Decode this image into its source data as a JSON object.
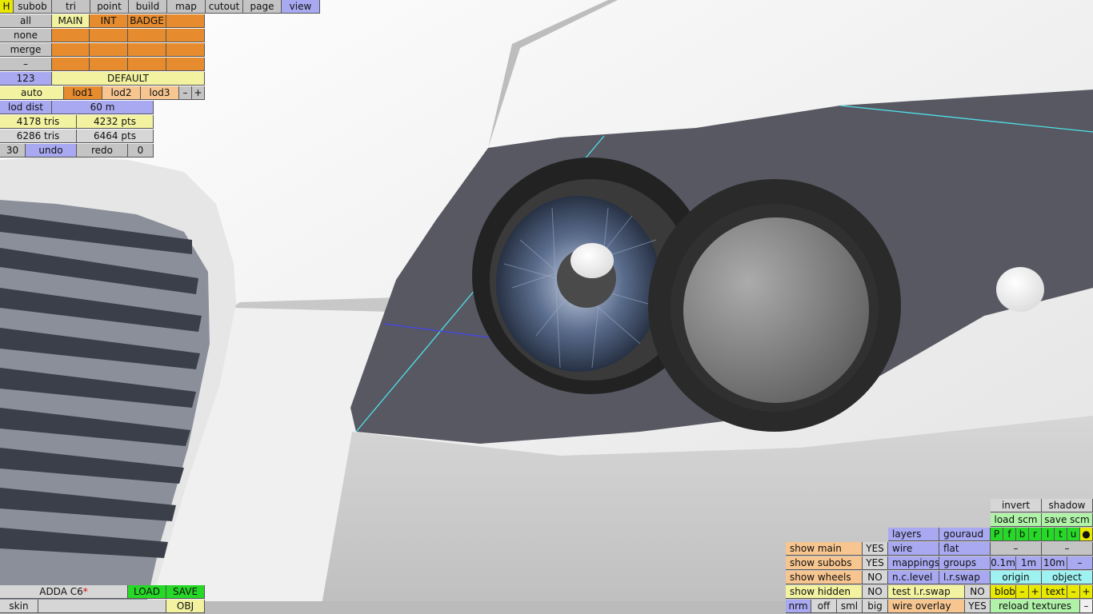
{
  "topbar": {
    "h": "H",
    "tabs": [
      "subob",
      "tri",
      "point",
      "build",
      "map",
      "cutout",
      "page",
      "view"
    ]
  },
  "layers": {
    "all": "all",
    "none": "none",
    "merge": "merge",
    "dash": "–",
    "num": "123",
    "main": "MAIN",
    "int": "INT",
    "badge": "BADGE",
    "default": "DEFAULT"
  },
  "lod": {
    "auto": "auto",
    "lod1": "lod1",
    "lod2": "lod2",
    "lod3": "lod3",
    "minus": "–",
    "plus": "+",
    "dist_label": "lod dist",
    "dist_value": "60 m"
  },
  "stats": {
    "tris1": "4178 tris",
    "pts1": "4232 pts",
    "tris2": "6286 tris",
    "pts2": "6464 pts"
  },
  "undo": {
    "count": "30",
    "undo": "undo",
    "redo": "redo",
    "redo_count": "0"
  },
  "file": {
    "name": "ADDA C6",
    "star": "*",
    "load": "LOAD",
    "save": "SAVE",
    "skin": "skin",
    "obj": "OBJ"
  },
  "right": {
    "invert": "invert",
    "shadow": "shadow",
    "load_scm": "load scm",
    "save_scm": "save scm",
    "layers": "layers",
    "gouraud": "gouraud",
    "p_letters": [
      "P",
      "f",
      "b",
      "r",
      "l",
      "t",
      "u",
      "●"
    ],
    "show_main": "show main",
    "show_main_v": "YES",
    "wire": "wire",
    "flat": "flat",
    "dash": "–",
    "show_subobs": "show subobs",
    "show_subobs_v": "YES",
    "mappings": "mappings",
    "groups": "groups",
    "m01": "0.1m",
    "m1": "1m",
    "m10": "10m",
    "show_wheels": "show wheels",
    "show_wheels_v": "NO",
    "nclevel": "n.c.level",
    "lrswap": "l.r.swap",
    "origin": "origin",
    "object": "object",
    "show_hidden": "show hidden",
    "show_hidden_v": "NO",
    "test_lrswap": "test l.r.swap",
    "test_lrswap_v": "NO",
    "blob": "blob",
    "text": "text",
    "plus": "+",
    "nrm": "nrm",
    "off": "off",
    "sml": "sml",
    "big": "big",
    "wire_overlay": "wire overlay",
    "wire_overlay_v": "YES",
    "reload_textures": "reload textures"
  }
}
